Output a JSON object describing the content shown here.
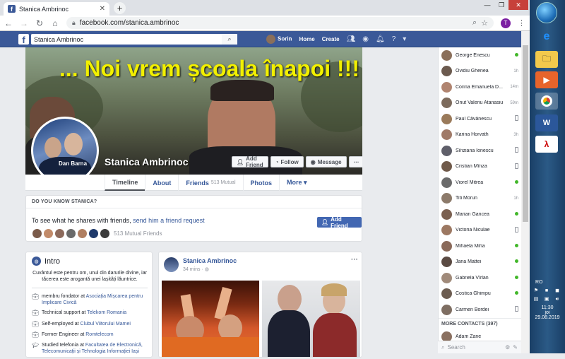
{
  "browser": {
    "tab_title": "Stanica Ambrinoc",
    "url": "facebook.com/stanica.ambrinoc",
    "profile_initial": "T"
  },
  "fb_bar": {
    "search_value": "Stanica Ambrinoc",
    "user_name": "Sorin",
    "home": "Home",
    "create": "Create"
  },
  "cover": {
    "banner_text": "... Noi vrem școala înapoi !!!",
    "profile_name": "Stanica Ambrinoc",
    "profile_pic_label": "Dan Barna",
    "add_friend": "Add Friend",
    "follow": "Follow",
    "message": "Message",
    "more": "···"
  },
  "tabs": [
    {
      "label": "Timeline",
      "count": ""
    },
    {
      "label": "About",
      "count": ""
    },
    {
      "label": "Friends",
      "count": "513 Mutual"
    },
    {
      "label": "Photos",
      "count": ""
    },
    {
      "label": "More ▾",
      "count": ""
    }
  ],
  "know": {
    "header": "DO YOU KNOW STANICA?",
    "text_prefix": "To see what he shares with friends,",
    "link": "send him a friend request",
    "add_friend": "Add Friend",
    "mutual": "513 Mutual Friends"
  },
  "intro": {
    "title": "Intro",
    "bio": "Cuvântul este pentru om, unul din darurile divine, iar tăcerea este arogantă unei lașități lăuntrice.",
    "items": [
      {
        "pre": "membru fondator at ",
        "link": "Asociația Mișcarea pentru Implicare Civică"
      },
      {
        "pre": "Technical support at ",
        "link": "Telekom Romania"
      },
      {
        "pre": "Self-employed at ",
        "link": "Clubul Viitorului Mamei"
      },
      {
        "pre": "Former Engineer at ",
        "link": "Romtelecom"
      },
      {
        "pre": "Studied telefonia at ",
        "link": "Facultatea de Electronică, Telecomunicații și Tehnologia Informației Iași"
      }
    ]
  },
  "post": {
    "author": "Stanica Ambrinoc",
    "time": "34 mins · ",
    "dots": "···"
  },
  "chat": {
    "contacts": [
      {
        "name": "George Enescu",
        "status": "dot"
      },
      {
        "name": "Ovidiu Ghenea",
        "status": "1h"
      },
      {
        "name": "Corina Emanuela D...",
        "status": "14m"
      },
      {
        "name": "Onut Valeriu Atanasiu",
        "status": "59m"
      },
      {
        "name": "Paul Căvănescu",
        "status": "mobile"
      },
      {
        "name": "Karina Horvath",
        "status": "3h"
      },
      {
        "name": "Sînziana Ionescu",
        "status": "mobile"
      },
      {
        "name": "Cristian Mînza",
        "status": "mobile"
      },
      {
        "name": "Viorel Mitrea",
        "status": "dot"
      },
      {
        "name": "Titi Morun",
        "status": "1h"
      },
      {
        "name": "Marian Gancea",
        "status": "dot"
      },
      {
        "name": "Victoria Niculae",
        "status": "mobile"
      },
      {
        "name": "Mihaela Miha",
        "status": "dot"
      },
      {
        "name": "Jana Mattei",
        "status": "dot"
      },
      {
        "name": "Gabriela Vîrlan",
        "status": "dot"
      },
      {
        "name": "Costica Ghimpu",
        "status": "dot"
      },
      {
        "name": "Carmen Bordei",
        "status": "mobile"
      }
    ],
    "more_contacts": "MORE CONTACTS (397)",
    "last_contact": "Adam Zane",
    "search": "Search"
  },
  "taskbar": {
    "lang": "RO",
    "time": "11:30",
    "day": "joi",
    "date": "29.08.2019"
  }
}
